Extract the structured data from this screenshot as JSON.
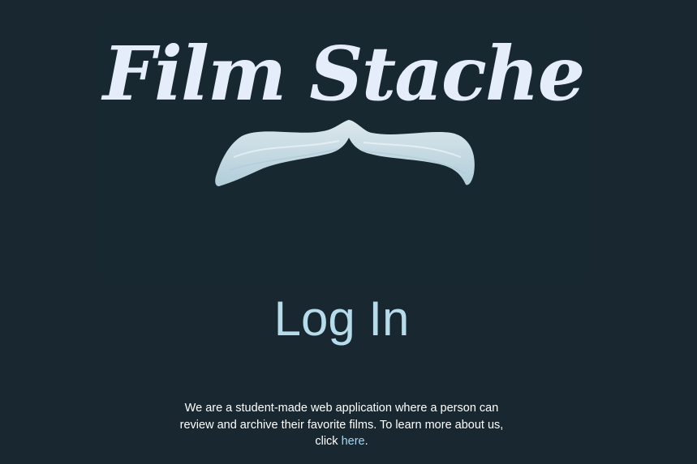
{
  "logo": {
    "text": "Film Stache",
    "color": "#e4edf9"
  },
  "login": {
    "title": "Log In"
  },
  "about": {
    "text_before": "We are a student-made web application where a person can review and archive their favorite films. To learn more about us, click ",
    "link_label": "here",
    "text_after": "."
  },
  "colors": {
    "background": "#182730",
    "title": "#b6dcec",
    "link": "#a8d6f0",
    "mustache": "#cfe6ef"
  }
}
